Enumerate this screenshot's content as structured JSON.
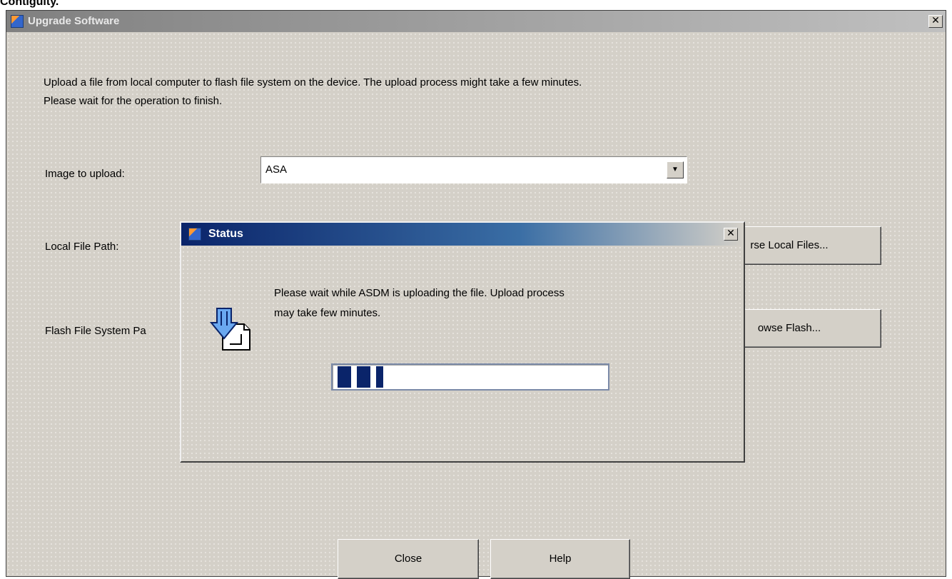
{
  "top_fragment": "Contiguity.",
  "main_window": {
    "title": "Upgrade Software",
    "close_glyph": "✕",
    "description_line1": "Upload a file from local computer to flash file system on the device. The upload process might take a few minutes.",
    "description_line2": "Please wait for the operation to finish.",
    "image_label": "Image to upload:",
    "image_value": "ASA",
    "local_path_label": "Local File Path:",
    "local_path_value": "",
    "flash_path_label": "Flash File System Pa",
    "browse_local_label": "rse Local Files...",
    "browse_flash_label": "owse Flash...",
    "close_button": "Close",
    "help_button": "Help"
  },
  "status_dialog": {
    "title": "Status",
    "close_glyph": "✕",
    "message_line1": "Please wait while ASDM is uploading the file. Upload process",
    "message_line2": "may take few minutes.",
    "progress_fraction": 0.18
  },
  "icons": {
    "app_icon": "asdm-app-icon",
    "upload_icon": "upload-arrow-document-icon",
    "dropdown_icon": "chevron-down-icon"
  },
  "colors": {
    "window_bg": "#d4d0c8",
    "active_titlebar": "#0a246a",
    "inactive_titlebar": "#808080",
    "progress_fill": "#0a246a"
  }
}
